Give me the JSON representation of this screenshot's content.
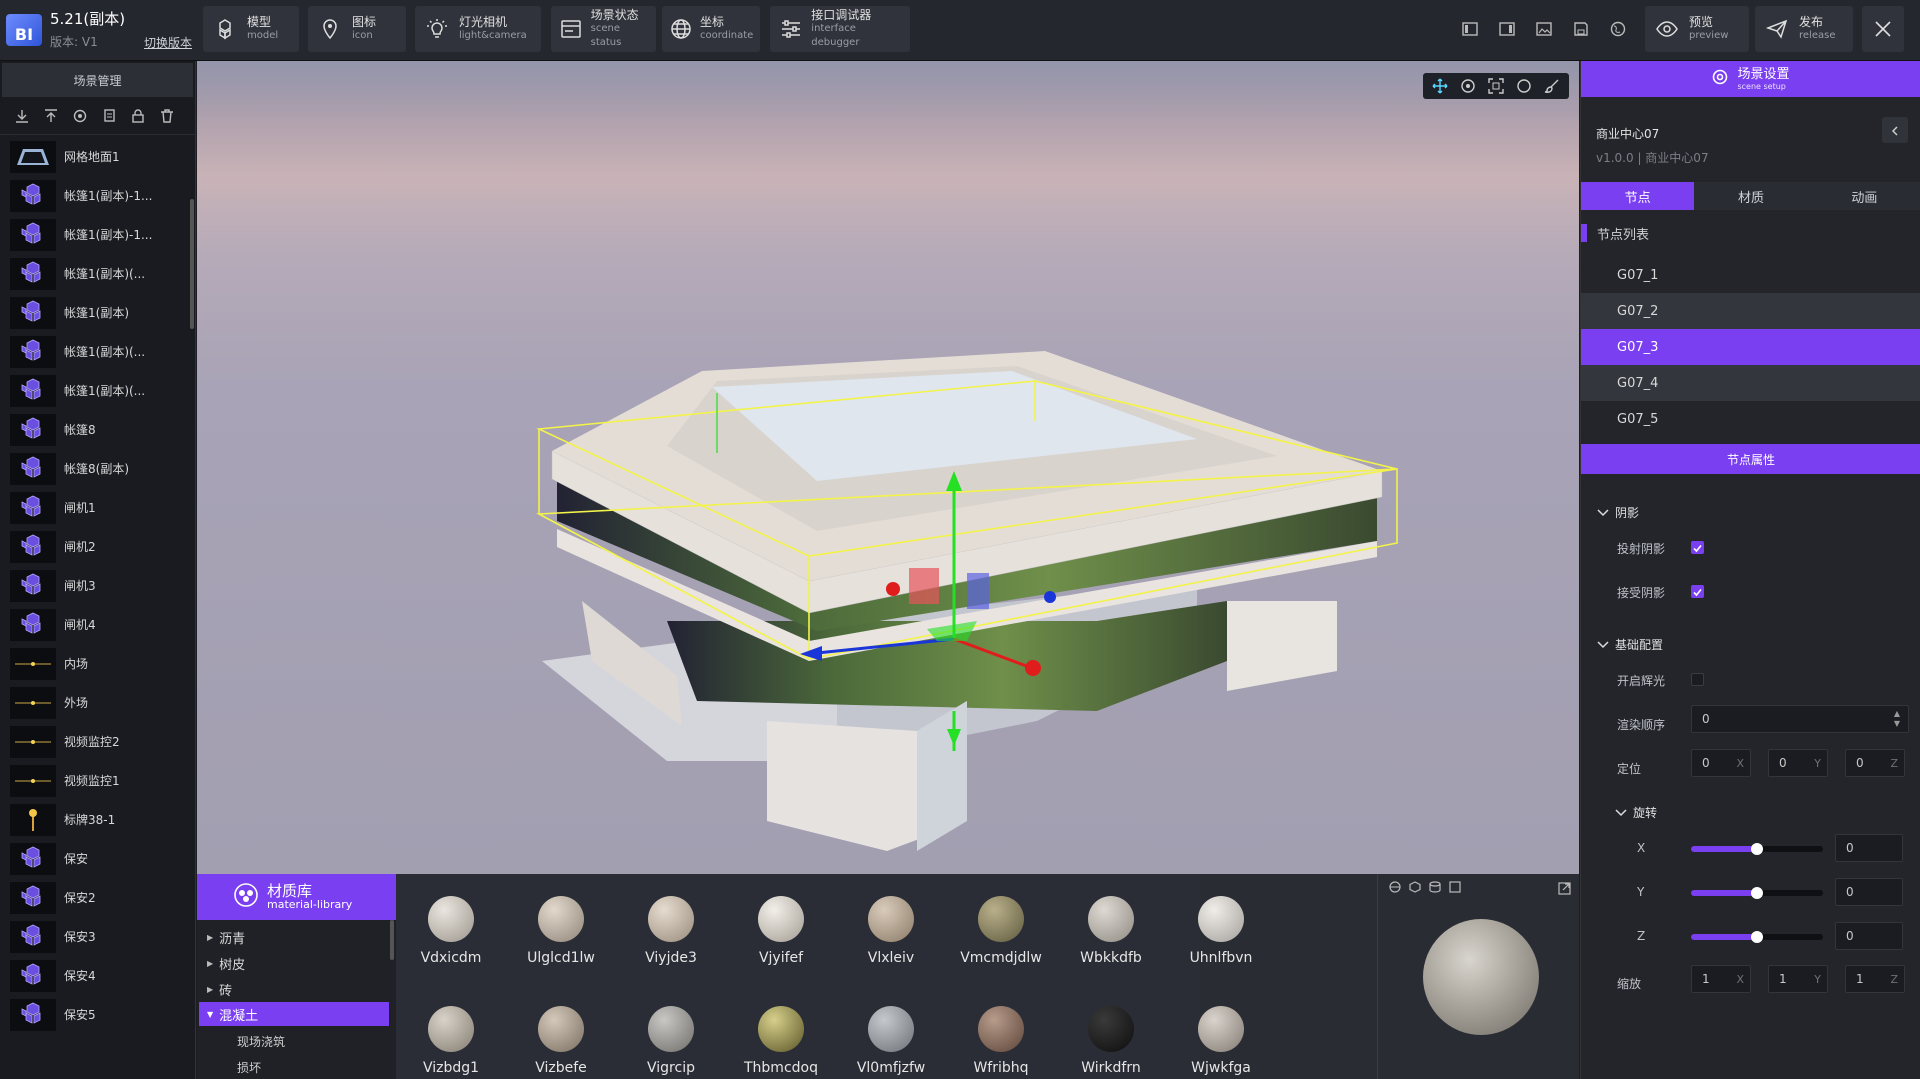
{
  "header": {
    "logo_text": "BI",
    "project_title": "5.21(副本)",
    "version_label": "版本: V1",
    "switch_version": "切换版本",
    "tools": [
      {
        "zh": "模型",
        "en": "model",
        "icon": "cubes-icon"
      },
      {
        "zh": "图标",
        "en": "icon",
        "icon": "location-pin-icon"
      },
      {
        "zh": "灯光相机",
        "en": "light&camera",
        "icon": "bulb-icon"
      },
      {
        "zh": "场景状态",
        "en": "scene status",
        "icon": "window-icon"
      },
      {
        "zh": "坐标",
        "en": "coordinate",
        "icon": "globe-icon"
      },
      {
        "zh": "接口调试器",
        "en": "interface debugger",
        "icon": "sliders-icon"
      }
    ],
    "preview": {
      "zh": "预览",
      "en": "preview"
    },
    "release": {
      "zh": "发布",
      "en": "release"
    }
  },
  "left_panel": {
    "title": "场景管理",
    "items": [
      {
        "label": "网格地面1",
        "type": "ground"
      },
      {
        "label": "帐篷1(副本)-1...",
        "type": "model"
      },
      {
        "label": "帐篷1(副本)-1...",
        "type": "model"
      },
      {
        "label": "帐篷1(副本)(...",
        "type": "model"
      },
      {
        "label": "帐篷1(副本)",
        "type": "model"
      },
      {
        "label": "帐篷1(副本)(...",
        "type": "model"
      },
      {
        "label": "帐篷1(副本)(...",
        "type": "model"
      },
      {
        "label": "帐篷8",
        "type": "model"
      },
      {
        "label": "帐篷8(副本)",
        "type": "model"
      },
      {
        "label": "闸机1",
        "type": "model"
      },
      {
        "label": "闸机2",
        "type": "model"
      },
      {
        "label": "闸机3",
        "type": "model"
      },
      {
        "label": "闸机4",
        "type": "model"
      },
      {
        "label": "内场",
        "type": "scene"
      },
      {
        "label": "外场",
        "type": "scene"
      },
      {
        "label": "视频监控2",
        "type": "scene"
      },
      {
        "label": "视频监控1",
        "type": "scene"
      },
      {
        "label": "标牌38-1",
        "type": "sign"
      },
      {
        "label": "保安",
        "type": "model"
      },
      {
        "label": "保安2",
        "type": "model"
      },
      {
        "label": "保安3",
        "type": "model"
      },
      {
        "label": "保安4",
        "type": "model"
      },
      {
        "label": "保安5",
        "type": "model"
      }
    ]
  },
  "right_panel": {
    "header": {
      "zh": "场景设置",
      "en": "scene setup"
    },
    "scene_name": "商业中心07",
    "scene_version": "v1.0.0 | 商业中心07",
    "tabs": [
      "节点",
      "材质",
      "动画"
    ],
    "active_tab": 0,
    "node_list_title": "节点列表",
    "nodes": [
      "G07_1",
      "G07_2",
      "G07_3",
      "G07_4",
      "G07_5"
    ],
    "selected_node": 2,
    "props_title": "节点属性",
    "shadow": {
      "title": "阴影",
      "cast": "投射阴影",
      "cast_on": true,
      "receive": "接受阴影",
      "receive_on": true
    },
    "basic": {
      "title": "基础配置",
      "bloom": "开启辉光",
      "bloom_on": false,
      "render_order": "渲染顺序",
      "render_order_value": "0",
      "position": "定位",
      "position_values": [
        "0",
        "0",
        "0"
      ],
      "axes": [
        "X",
        "Y",
        "Z"
      ]
    },
    "rotation": {
      "title": "旋转",
      "items": [
        {
          "axis": "X",
          "value": "0",
          "level": 0.5
        },
        {
          "axis": "Y",
          "value": "0",
          "level": 0.5
        },
        {
          "axis": "Z",
          "value": "0",
          "level": 0.5
        }
      ]
    },
    "scale": {
      "label": "缩放",
      "values": [
        "1",
        "1",
        "1"
      ]
    },
    "accent_color": "#7b3ff2"
  },
  "material_library": {
    "title_zh": "材质库",
    "title_en": "material-library",
    "categories": [
      "沥青",
      "树皮",
      "砖",
      "混凝土"
    ],
    "selected_category": "混凝土",
    "subcategories": [
      "现场浇筑",
      "损坏"
    ],
    "materials_row1": [
      "Vdxicdm",
      "Ulglcd1lw",
      "Viyjde3",
      "Vjyifef",
      "Vlxleiv",
      "Vmcmdjdlw",
      "Wbkkdfb",
      "Uhnlfbvn"
    ],
    "materials_row2": [
      "Vizbdg1",
      "Vizbefe",
      "Vigrcip",
      "Thbmcdoq",
      "Vl0mfjzfw",
      "Wfribhq",
      "Wirkdfrn",
      "Wjwkfga"
    ]
  }
}
